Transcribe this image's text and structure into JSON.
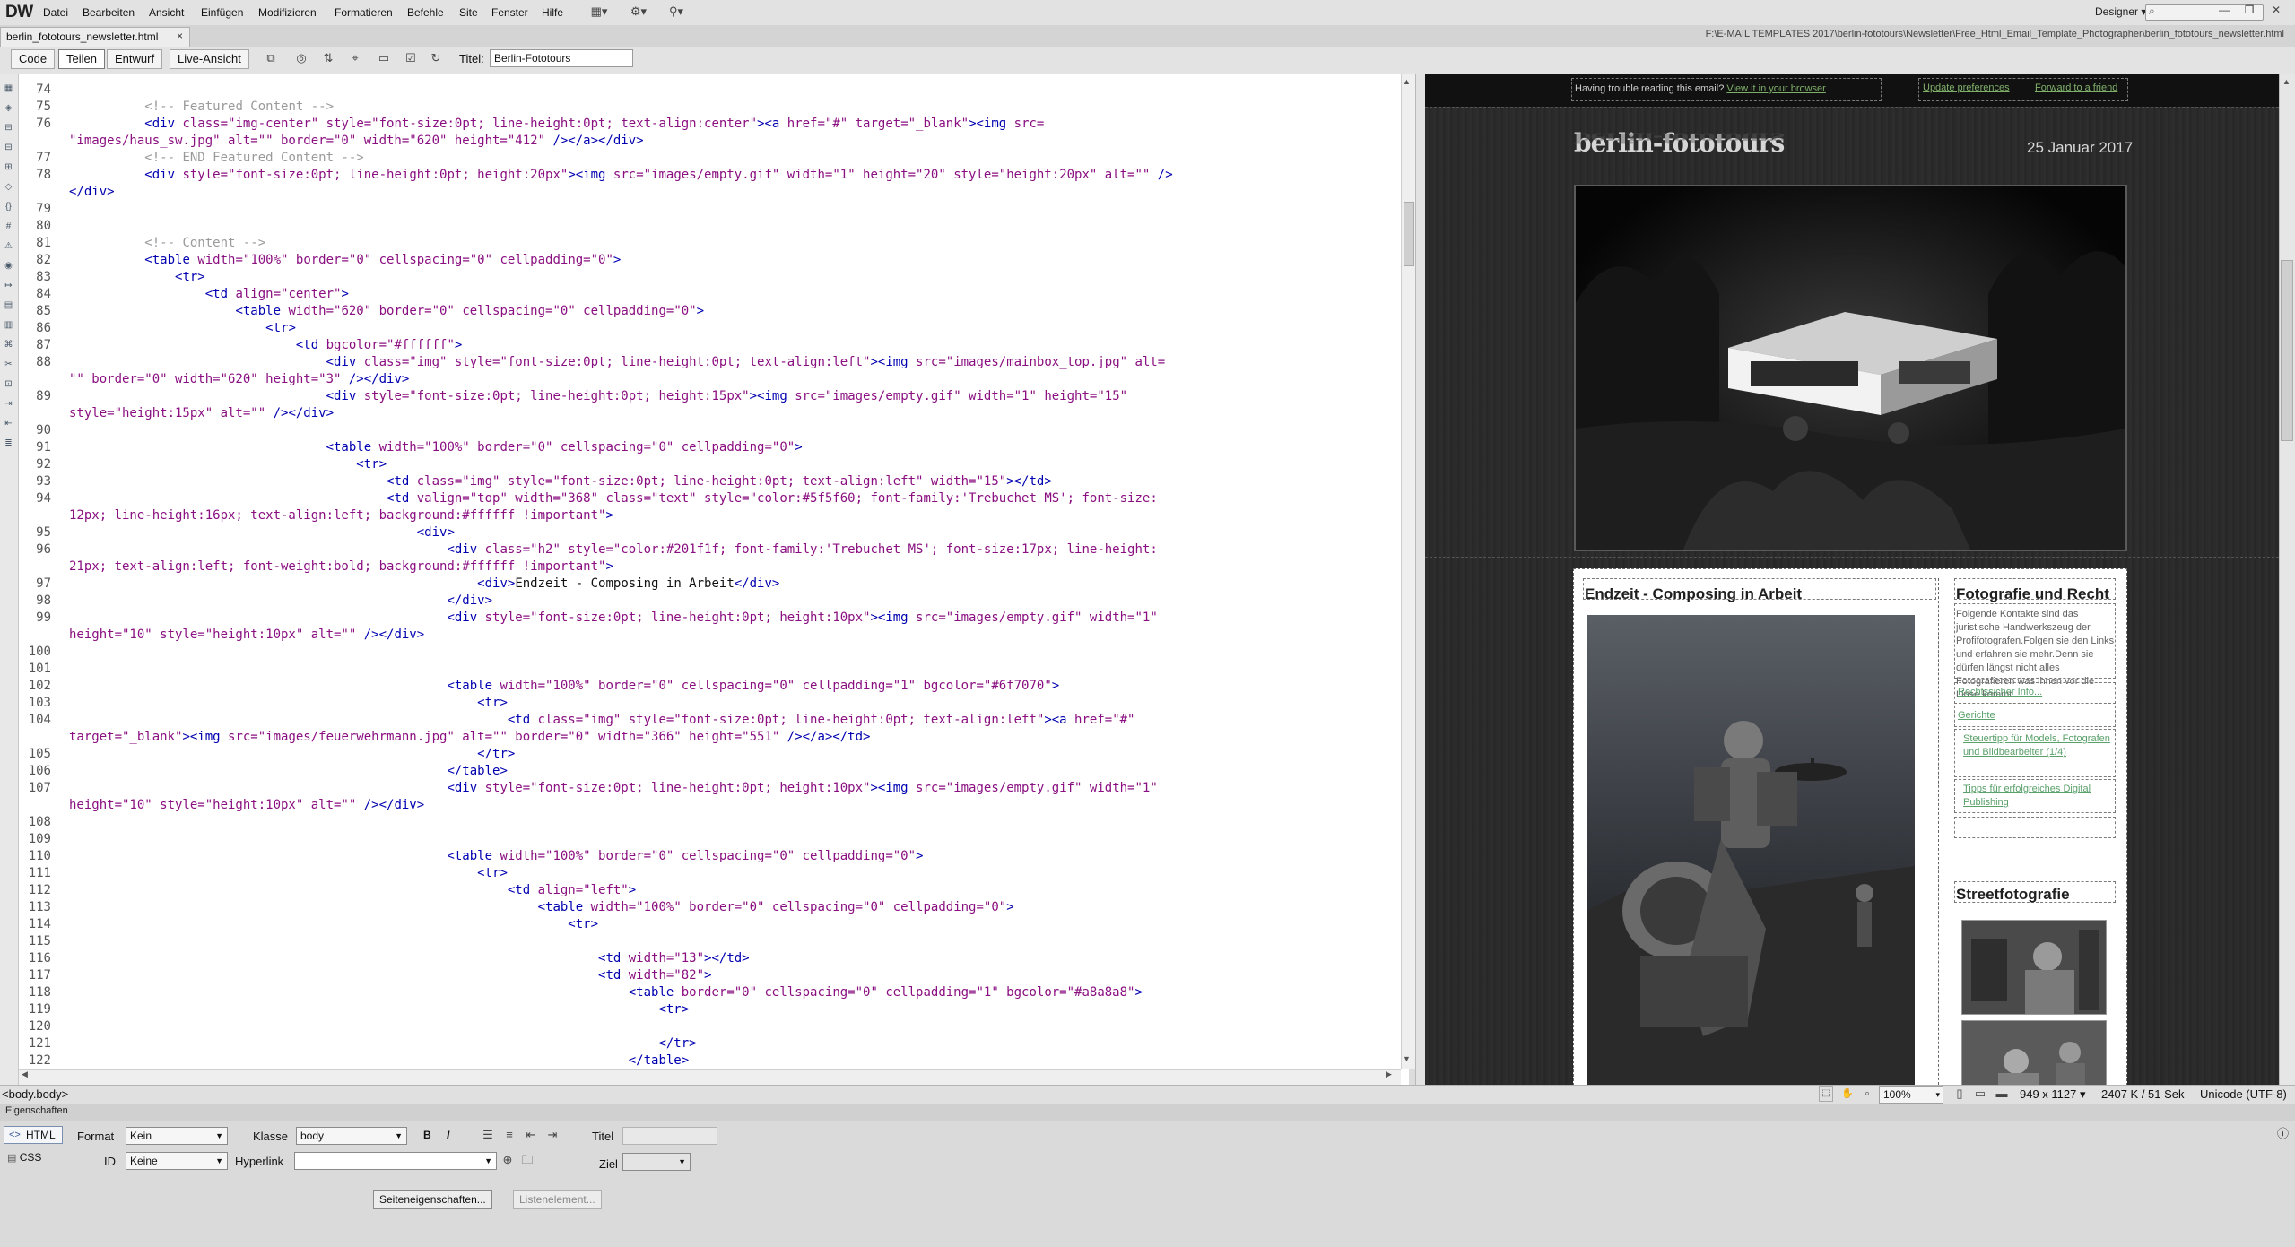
{
  "app": {
    "logo": "DW",
    "menu": [
      "Datei",
      "Bearbeiten",
      "Ansicht",
      "Einfügen",
      "Modifizieren",
      "Formatieren",
      "Befehle",
      "Site",
      "Fenster",
      "Hilfe"
    ],
    "workspace": "Designer",
    "window_buttons": [
      "—",
      "❐",
      "✕"
    ]
  },
  "document": {
    "tab_name": "berlin_fototours_newsletter.html",
    "tab_close": "×",
    "file_path": "F:\\E-MAIL TEMPLATES 2017\\berlin-fototours\\Newsletter\\Free_Html_Email_Template_Photographer\\berlin_fototours_newsletter.html"
  },
  "toolbar": {
    "views": [
      "Code",
      "Teilen",
      "Entwurf",
      "Live-Ansicht"
    ],
    "active_view": "Teilen",
    "title_label": "Titel:",
    "title_value": "Berlin-Fototours"
  },
  "code_lines": [
    {
      "n": "74",
      "parts": []
    },
    {
      "n": "75",
      "parts": [
        {
          "t": "          "
        },
        {
          "c": "<!-- Featured Content -->"
        }
      ]
    },
    {
      "n": "76",
      "parts": [
        {
          "t": "          "
        },
        {
          "t": "<div "
        },
        {
          "s": "class=\"img-center\" style=\"font-size:0pt; line-height:0pt; text-align:center\""
        },
        {
          "t": "><a "
        },
        {
          "s": "href=\"#\" target=\"_blank\""
        },
        {
          "t": "><img "
        },
        {
          "s": "src="
        }
      ]
    },
    {
      "n": "",
      "parts": [
        {
          "s": "\"images/haus_sw.jpg\" alt=\"\" border=\"0\" width=\"620\" height=\"412\""
        },
        {
          "t": " /></a></div>"
        }
      ]
    },
    {
      "n": "77",
      "parts": [
        {
          "t": "          "
        },
        {
          "c": "<!-- END Featured Content -->"
        }
      ]
    },
    {
      "n": "78",
      "parts": [
        {
          "t": "          "
        },
        {
          "t": "<div "
        },
        {
          "s": "style=\"font-size:0pt; line-height:0pt; height:20px\""
        },
        {
          "t": "><img "
        },
        {
          "s": "src=\"images/empty.gif\" width=\"1\" height=\"20\" style=\"height:20px\" alt=\"\""
        },
        {
          "t": " />"
        }
      ]
    },
    {
      "n": "",
      "parts": [
        {
          "t": "</div>"
        }
      ]
    },
    {
      "n": "79",
      "parts": []
    },
    {
      "n": "80",
      "parts": []
    },
    {
      "n": "81",
      "parts": [
        {
          "t": "          "
        },
        {
          "c": "<!-- Content -->"
        }
      ]
    },
    {
      "n": "82",
      "parts": [
        {
          "t": "          "
        },
        {
          "t": "<table "
        },
        {
          "s": "width=\"100%\" border=\"0\" cellspacing=\"0\" cellpadding=\"0\""
        },
        {
          "t": ">"
        }
      ]
    },
    {
      "n": "83",
      "parts": [
        {
          "t": "              "
        },
        {
          "t": "<tr>"
        }
      ]
    },
    {
      "n": "84",
      "parts": [
        {
          "t": "                  "
        },
        {
          "t": "<td "
        },
        {
          "s": "align=\"center\""
        },
        {
          "t": ">"
        }
      ]
    },
    {
      "n": "85",
      "parts": [
        {
          "t": "                      "
        },
        {
          "t": "<table "
        },
        {
          "s": "width=\"620\" border=\"0\" cellspacing=\"0\" cellpadding=\"0\""
        },
        {
          "t": ">"
        }
      ]
    },
    {
      "n": "86",
      "parts": [
        {
          "t": "                          "
        },
        {
          "t": "<tr>"
        }
      ]
    },
    {
      "n": "87",
      "parts": [
        {
          "t": "                              "
        },
        {
          "t": "<td "
        },
        {
          "s": "bgcolor=\"#ffffff\""
        },
        {
          "t": ">"
        }
      ]
    },
    {
      "n": "88",
      "parts": [
        {
          "t": "                                  "
        },
        {
          "t": "<div "
        },
        {
          "s": "class=\"img\" style=\"font-size:0pt; line-height:0pt; text-align:left\""
        },
        {
          "t": "><img "
        },
        {
          "s": "src=\"images/mainbox_top.jpg\" alt="
        }
      ]
    },
    {
      "n": "",
      "parts": [
        {
          "s": "\"\" border=\"0\" width=\"620\" height=\"3\""
        },
        {
          "t": " /></div>"
        }
      ]
    },
    {
      "n": "89",
      "parts": [
        {
          "t": "                                  "
        },
        {
          "t": "<div "
        },
        {
          "s": "style=\"font-size:0pt; line-height:0pt; height:15px\""
        },
        {
          "t": "><img "
        },
        {
          "s": "src=\"images/empty.gif\" width=\"1\" height=\"15\""
        }
      ]
    },
    {
      "n": "",
      "parts": [
        {
          "s": "style=\"height:15px\" alt=\"\""
        },
        {
          "t": " /></div>"
        }
      ]
    },
    {
      "n": "90",
      "parts": []
    },
    {
      "n": "91",
      "parts": [
        {
          "t": "                                  "
        },
        {
          "t": "<table "
        },
        {
          "s": "width=\"100%\" border=\"0\" cellspacing=\"0\" cellpadding=\"0\""
        },
        {
          "t": ">"
        }
      ]
    },
    {
      "n": "92",
      "parts": [
        {
          "t": "                                      "
        },
        {
          "t": "<tr>"
        }
      ]
    },
    {
      "n": "93",
      "parts": [
        {
          "t": "                                          "
        },
        {
          "t": "<td "
        },
        {
          "s": "class=\"img\" style=\"font-size:0pt; line-height:0pt; text-align:left\" width=\"15\""
        },
        {
          "t": "></td>"
        }
      ]
    },
    {
      "n": "94",
      "parts": [
        {
          "t": "                                          "
        },
        {
          "t": "<td "
        },
        {
          "s": "valign=\"top\" width=\"368\" class=\"text\" style=\"color:#5f5f60; font-family:'Trebuchet MS'; font-size:"
        }
      ]
    },
    {
      "n": "",
      "parts": [
        {
          "s": "12px; line-height:16px; text-align:left; background:#ffffff !important\""
        },
        {
          "t": ">"
        }
      ]
    },
    {
      "n": "95",
      "parts": [
        {
          "t": "                                              "
        },
        {
          "t": "<div>"
        }
      ]
    },
    {
      "n": "96",
      "parts": [
        {
          "t": "                                                  "
        },
        {
          "t": "<div "
        },
        {
          "s": "class=\"h2\" style=\"color:#201f1f; font-family:'Trebuchet MS'; font-size:17px; line-height:"
        }
      ]
    },
    {
      "n": "",
      "parts": [
        {
          "s": "21px; text-align:left; font-weight:bold; background:#ffffff !important\""
        },
        {
          "t": ">"
        }
      ]
    },
    {
      "n": "97",
      "parts": [
        {
          "t": "                                                      "
        },
        {
          "t": "<div>"
        },
        {
          "x": "Endzeit - Composing in Arbeit"
        },
        {
          "t": "</div>"
        }
      ]
    },
    {
      "n": "98",
      "parts": [
        {
          "t": "                                                  "
        },
        {
          "t": "</div>"
        }
      ]
    },
    {
      "n": "99",
      "parts": [
        {
          "t": "                                                  "
        },
        {
          "t": "<div "
        },
        {
          "s": "style=\"font-size:0pt; line-height:0pt; height:10px\""
        },
        {
          "t": "><img "
        },
        {
          "s": "src=\"images/empty.gif\" width=\"1\""
        }
      ]
    },
    {
      "n": "",
      "parts": [
        {
          "s": "height=\"10\" style=\"height:10px\" alt=\"\""
        },
        {
          "t": " /></div>"
        }
      ]
    },
    {
      "n": "100",
      "parts": []
    },
    {
      "n": "101",
      "parts": []
    },
    {
      "n": "102",
      "parts": [
        {
          "t": "                                                  "
        },
        {
          "t": "<table "
        },
        {
          "s": "width=\"100%\" border=\"0\" cellspacing=\"0\" cellpadding=\"1\" bgcolor=\"#6f7070\""
        },
        {
          "t": ">"
        }
      ]
    },
    {
      "n": "103",
      "parts": [
        {
          "t": "                                                      "
        },
        {
          "t": "<tr>"
        }
      ]
    },
    {
      "n": "104",
      "parts": [
        {
          "t": "                                                          "
        },
        {
          "t": "<td "
        },
        {
          "s": "class=\"img\" style=\"font-size:0pt; line-height:0pt; text-align:left\""
        },
        {
          "t": "><a "
        },
        {
          "s": "href=\"#\""
        }
      ]
    },
    {
      "n": "",
      "parts": [
        {
          "s": "target=\"_blank\""
        },
        {
          "t": "><img "
        },
        {
          "s": "src=\"images/feuerwehrmann.jpg\" alt=\"\" border=\"0\" width=\"366\" height=\"551\""
        },
        {
          "t": " /></a></td>"
        }
      ]
    },
    {
      "n": "105",
      "parts": [
        {
          "t": "                                                      "
        },
        {
          "t": "</tr>"
        }
      ]
    },
    {
      "n": "106",
      "parts": [
        {
          "t": "                                                  "
        },
        {
          "t": "</table>"
        }
      ]
    },
    {
      "n": "107",
      "parts": [
        {
          "t": "                                                  "
        },
        {
          "t": "<div "
        },
        {
          "s": "style=\"font-size:0pt; line-height:0pt; height:10px\""
        },
        {
          "t": "><img "
        },
        {
          "s": "src=\"images/empty.gif\" width=\"1\""
        }
      ]
    },
    {
      "n": "",
      "parts": [
        {
          "s": "height=\"10\" style=\"height:10px\" alt=\"\""
        },
        {
          "t": " /></div>"
        }
      ]
    },
    {
      "n": "108",
      "parts": []
    },
    {
      "n": "109",
      "parts": []
    },
    {
      "n": "110",
      "parts": [
        {
          "t": "                                                  "
        },
        {
          "t": "<table "
        },
        {
          "s": "width=\"100%\" border=\"0\" cellspacing=\"0\" cellpadding=\"0\""
        },
        {
          "t": ">"
        }
      ]
    },
    {
      "n": "111",
      "parts": [
        {
          "t": "                                                      "
        },
        {
          "t": "<tr>"
        }
      ]
    },
    {
      "n": "112",
      "parts": [
        {
          "t": "                                                          "
        },
        {
          "t": "<td "
        },
        {
          "s": "align=\"left\""
        },
        {
          "t": ">"
        }
      ]
    },
    {
      "n": "113",
      "parts": [
        {
          "t": "                                                              "
        },
        {
          "t": "<table "
        },
        {
          "s": "width=\"100%\" border=\"0\" cellspacing=\"0\" cellpadding=\"0\""
        },
        {
          "t": ">"
        }
      ]
    },
    {
      "n": "114",
      "parts": [
        {
          "t": "                                                                  "
        },
        {
          "t": "<tr>"
        }
      ]
    },
    {
      "n": "115",
      "parts": []
    },
    {
      "n": "116",
      "parts": [
        {
          "t": "                                                                      "
        },
        {
          "t": "<td "
        },
        {
          "s": "width=\"13\""
        },
        {
          "t": "></td>"
        }
      ]
    },
    {
      "n": "117",
      "parts": [
        {
          "t": "                                                                      "
        },
        {
          "t": "<td "
        },
        {
          "s": "width=\"82\""
        },
        {
          "t": ">"
        }
      ]
    },
    {
      "n": "118",
      "parts": [
        {
          "t": "                                                                          "
        },
        {
          "t": "<table "
        },
        {
          "s": "border=\"0\" cellspacing=\"0\" cellpadding=\"1\" bgcolor=\"#a8a8a8\""
        },
        {
          "t": ">"
        }
      ]
    },
    {
      "n": "119",
      "parts": [
        {
          "t": "                                                                              "
        },
        {
          "t": "<tr>"
        }
      ]
    },
    {
      "n": "120",
      "parts": []
    },
    {
      "n": "121",
      "parts": [
        {
          "t": "                                                                              "
        },
        {
          "t": "</tr>"
        }
      ]
    },
    {
      "n": "122",
      "parts": [
        {
          "t": "                                                                          "
        },
        {
          "t": "</table>"
        }
      ]
    }
  ],
  "live": {
    "trouble_text": "Having trouble reading this email?",
    "view_in_browser": "View it in your browser",
    "update_prefs": "Update preferences",
    "forward": "Forward to a friend",
    "logo": "berlin-fototours",
    "date": "25 Januar 2017",
    "article_title": "Endzeit - Composing in Arbeit",
    "side_title": "Fotografie und Recht",
    "side_text": "Folgende Kontakte sind das juristische Handwerkszeug der Profifotografen.Folgen sie den Links und erfahren sie mehr.Denn sie dürfen längst nicht alles Fotografieren was ihnen vor die Linse kommt",
    "side_links": [
      "Rechtssicher Info...",
      "Gerichte",
      "Steuertipp für Models, Fotografen und Bildbearbeiter (1/4)",
      "Tipps für erfolgreiches Digital Publishing"
    ],
    "street_title": "Streetfotografie"
  },
  "status": {
    "tag_selector": "<body.body>",
    "zoom": "100%",
    "dimensions": "949 x 1127",
    "size_time": "2407 K / 51 Sek",
    "encoding": "Unicode (UTF-8)"
  },
  "props": {
    "panel_title": "Eigenschaften",
    "html_label": "HTML",
    "css_label": "CSS",
    "format_label": "Format",
    "format_value": "Kein",
    "class_label": "Klasse",
    "class_value": "body",
    "id_label": "ID",
    "id_value": "Keine",
    "hyperlink_label": "Hyperlink",
    "title_label": "Titel",
    "target_label": "Ziel",
    "page_props_button": "Seiteneigenschaften...",
    "list_item_button": "Listenelement..."
  },
  "colors": {
    "tag": "#0000b0",
    "attribute": "#8a0f80",
    "comment": "#9a9a9a",
    "link_green": "#7fb06a"
  }
}
